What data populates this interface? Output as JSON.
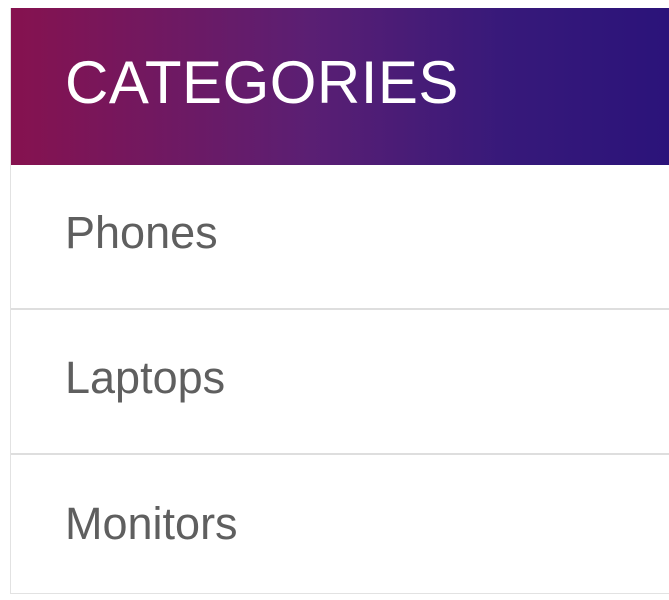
{
  "header": {
    "title": "CATEGORIES",
    "gradient_start": "#86124f",
    "gradient_end": "#2b137a"
  },
  "categories": [
    {
      "label": "Phones"
    },
    {
      "label": "Laptops"
    },
    {
      "label": "Monitors"
    }
  ],
  "colors": {
    "item_text": "#5f5f5f",
    "divider": "#dedede",
    "header_text": "#ffffff"
  }
}
